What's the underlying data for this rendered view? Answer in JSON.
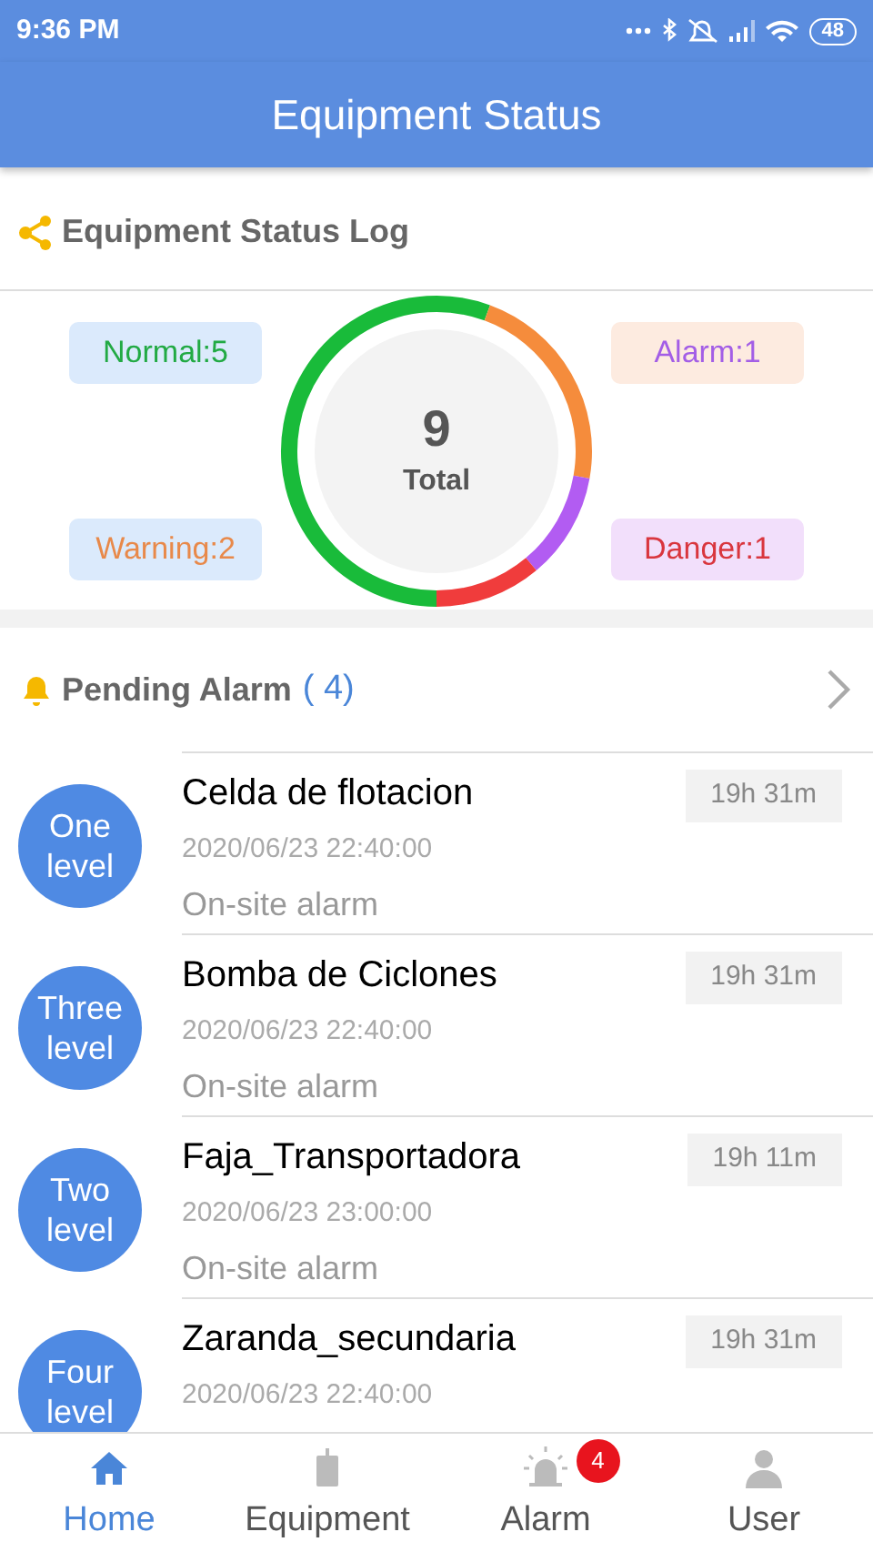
{
  "status_bar": {
    "time": "9:36 PM",
    "battery": "48"
  },
  "header": {
    "title": "Equipment Status"
  },
  "status_log": {
    "title": "Equipment Status Log",
    "legend": [
      {
        "label": "Normal:5",
        "color": "#22aa44"
      },
      {
        "label": "Alarm:1",
        "color": "#a35ee6"
      },
      {
        "label": "Warning:2",
        "color": "#e8894a"
      },
      {
        "label": "Danger:1",
        "color": "#d9363e"
      }
    ],
    "total": "9",
    "total_label": "Total",
    "ring": [
      {
        "color": "#19bb3a"
      },
      {
        "color": "#f58c3c"
      },
      {
        "color": "#b25cf2"
      },
      {
        "color": "#f03c3c"
      }
    ]
  },
  "pending": {
    "title": "Pending Alarm",
    "count": "( 4)",
    "alarms": [
      {
        "level": "One level",
        "name": "Celda de flotacion",
        "time": "2020/06/23 22:40:00",
        "type": "On-site alarm",
        "duration": "19h 31m"
      },
      {
        "level": "Three level",
        "name": "Bomba de Ciclones",
        "time": "2020/06/23 22:40:00",
        "type": "On-site alarm",
        "duration": "19h 31m"
      },
      {
        "level": "Two level",
        "name": "Faja_Transportadora",
        "time": "2020/06/23 23:00:00",
        "type": "On-site alarm",
        "duration": "19h 11m"
      },
      {
        "level": "Four level",
        "name": "Zaranda_secundaria",
        "time": "2020/06/23 22:40:00",
        "duration": "19h 31m"
      }
    ]
  },
  "tabs": [
    {
      "label": "Home",
      "selected": true,
      "kind": "home"
    },
    {
      "label": "Equipment",
      "selected": false,
      "kind": "equipment"
    },
    {
      "label": "Alarm",
      "selected": false,
      "kind": "alarm",
      "badge": "4"
    },
    {
      "label": "User",
      "selected": false,
      "kind": "user"
    }
  ]
}
